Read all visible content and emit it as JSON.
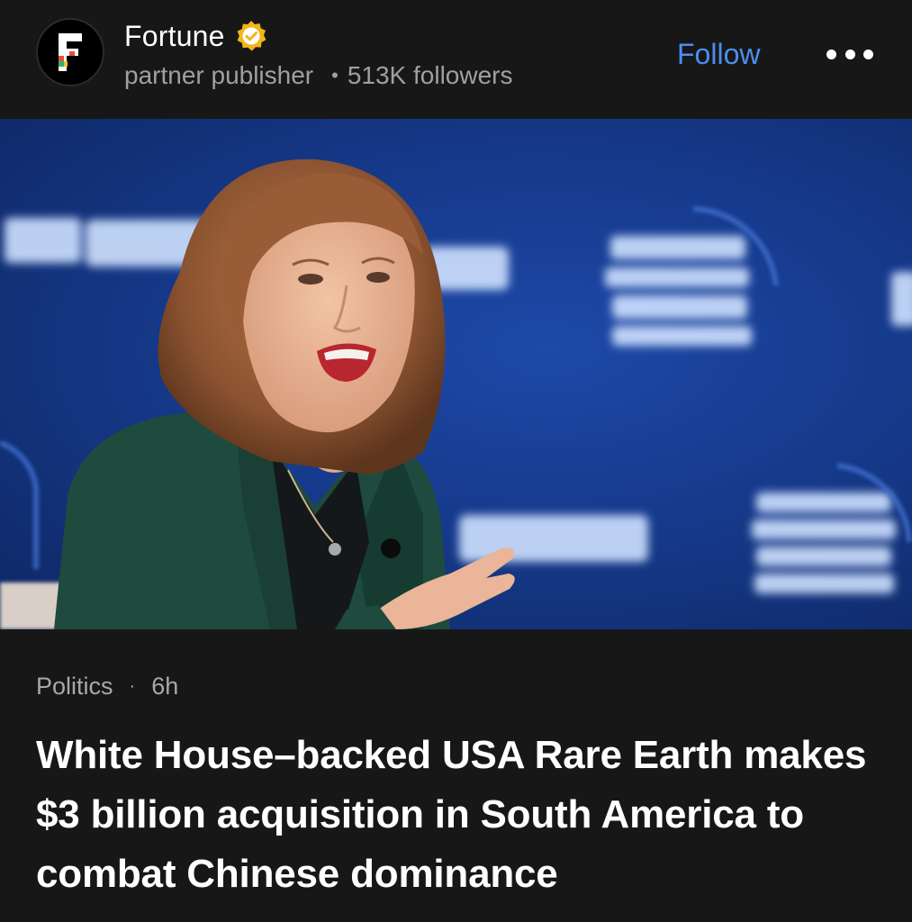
{
  "publisher": {
    "name": "Fortune",
    "logo_icon": "fortune-f-logo",
    "verified_icon": "verified-badge-icon",
    "verified_color": "#f2b61c",
    "type": "partner publisher",
    "followers": "513K followers",
    "follow_label": "Follow",
    "more_icon": "more-horizontal-icon"
  },
  "colors": {
    "background": "#171717",
    "accent": "#4a8ff0",
    "secondary_text": "#a0a0a0"
  },
  "article": {
    "category": "Politics",
    "age": "6h",
    "headline": "White House–backed USA Rare Earth makes $3 billion acquisition in South America to combat Chinese dominance",
    "image": "photo-speaker-on-stage"
  }
}
